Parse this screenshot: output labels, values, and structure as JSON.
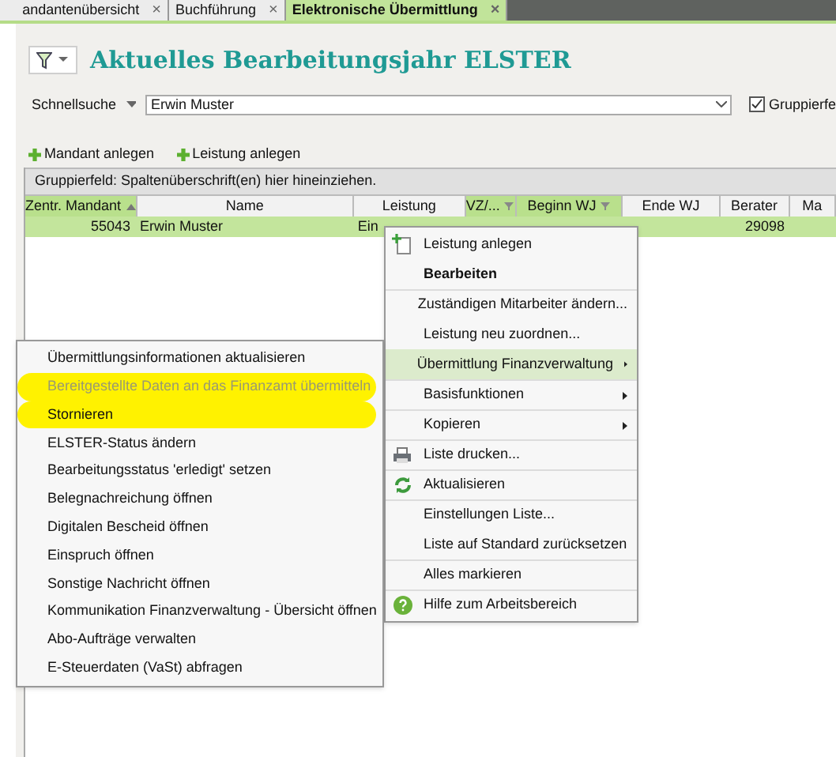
{
  "tabs": [
    {
      "label": "andantenübersicht",
      "selected": false,
      "close": "×"
    },
    {
      "label": "Buchführung",
      "selected": false,
      "close": "×"
    },
    {
      "label": "Elektronische Übermittlung",
      "selected": true,
      "close": "×"
    }
  ],
  "title": "Aktuelles Bearbeitungsjahr ELSTER",
  "search": {
    "label": "Schnellsuche",
    "value": "Erwin Muster"
  },
  "group_checkbox": {
    "label": "Gruppierfe",
    "checked": true
  },
  "toolbar": [
    "Mandant anlegen",
    "Leistung anlegen"
  ],
  "group_panel": "Gruppierfeld: Spaltenüberschrift(en) hier hineinziehen.",
  "table": {
    "columns": [
      {
        "label": "Zentr. Mandant",
        "highlighted": true,
        "sorted": true,
        "filtered": false
      },
      {
        "label": "Name",
        "highlighted": false,
        "sorted": false,
        "filtered": false
      },
      {
        "label": "Leistung",
        "highlighted": false,
        "sorted": false,
        "filtered": false
      },
      {
        "label": "VZ/...",
        "highlighted": true,
        "sorted": false,
        "filtered": true
      },
      {
        "label": "Beginn WJ",
        "highlighted": true,
        "sorted": false,
        "filtered": true
      },
      {
        "label": "Ende WJ",
        "highlighted": false,
        "sorted": false,
        "filtered": false
      },
      {
        "label": "Berater",
        "highlighted": false,
        "sorted": false,
        "filtered": false
      },
      {
        "label": "Ma",
        "highlighted": false,
        "sorted": false,
        "filtered": false
      }
    ],
    "rows": [
      {
        "selected": true,
        "cells": [
          "55043",
          "Erwin Muster",
          "Ein",
          "",
          "",
          "",
          "29098",
          ""
        ]
      }
    ]
  },
  "context_menu": [
    {
      "label": "Leistung anlegen",
      "kind": "add",
      "bold": false,
      "separator_before": false,
      "submenu": false,
      "selected": false
    },
    {
      "label": "Bearbeiten",
      "kind": "plain",
      "bold": true,
      "separator_before": false,
      "submenu": false,
      "selected": false
    },
    {
      "label": "Zuständigen Mitarbeiter ändern...",
      "kind": "plain",
      "bold": false,
      "separator_before": true,
      "submenu": false,
      "selected": false
    },
    {
      "label": "Leistung neu zuordnen...",
      "kind": "plain",
      "bold": false,
      "separator_before": false,
      "submenu": false,
      "selected": false
    },
    {
      "label": "Übermittlung Finanzverwaltung",
      "kind": "plain",
      "bold": false,
      "separator_before": false,
      "submenu": true,
      "selected": true
    },
    {
      "label": "Basisfunktionen",
      "kind": "plain",
      "bold": false,
      "separator_before": true,
      "submenu": true,
      "selected": false
    },
    {
      "label": "Kopieren",
      "kind": "plain",
      "bold": false,
      "separator_before": true,
      "submenu": true,
      "selected": false
    },
    {
      "label": "Liste drucken...",
      "kind": "printer",
      "bold": false,
      "separator_before": true,
      "submenu": false,
      "selected": false
    },
    {
      "label": "Aktualisieren",
      "kind": "refresh",
      "bold": false,
      "separator_before": true,
      "submenu": false,
      "selected": false
    },
    {
      "label": "Einstellungen Liste...",
      "kind": "plain",
      "bold": false,
      "separator_before": true,
      "submenu": false,
      "selected": false
    },
    {
      "label": "Liste auf Standard zurücksetzen",
      "kind": "plain",
      "bold": false,
      "separator_before": false,
      "submenu": false,
      "selected": false
    },
    {
      "label": "Alles markieren",
      "kind": "plain",
      "bold": false,
      "separator_before": true,
      "submenu": false,
      "selected": false
    },
    {
      "label": "Hilfe zum Arbeitsbereich",
      "kind": "help",
      "bold": false,
      "separator_before": true,
      "submenu": false,
      "selected": false
    }
  ],
  "submenu": [
    {
      "label": "Übermittlungsinformationen aktualisieren",
      "disabled": false,
      "highlighted": false
    },
    {
      "label": "Bereitgestellte Daten an das Finanzamt übermitteln",
      "disabled": true,
      "highlighted": true
    },
    {
      "label": "Stornieren",
      "disabled": false,
      "highlighted": true
    },
    {
      "label": "ELSTER-Status ändern",
      "disabled": false,
      "highlighted": false
    },
    {
      "label": "Bearbeitungsstatus 'erledigt' setzen",
      "disabled": false,
      "highlighted": false
    },
    {
      "label": "Belegnachreichung öffnen",
      "disabled": false,
      "highlighted": false
    },
    {
      "label": "Digitalen Bescheid öffnen",
      "disabled": false,
      "highlighted": false
    },
    {
      "label": "Einspruch öffnen",
      "disabled": false,
      "highlighted": false
    },
    {
      "label": "Sonstige Nachricht öffnen",
      "disabled": false,
      "highlighted": false
    },
    {
      "label": "Kommunikation Finanzverwaltung - Übersicht öffnen",
      "disabled": false,
      "highlighted": false
    },
    {
      "label": "Abo-Aufträge verwalten",
      "disabled": false,
      "highlighted": false
    },
    {
      "label": "E-Steuerdaten (VaSt) abfragen",
      "disabled": false,
      "highlighted": false
    }
  ]
}
